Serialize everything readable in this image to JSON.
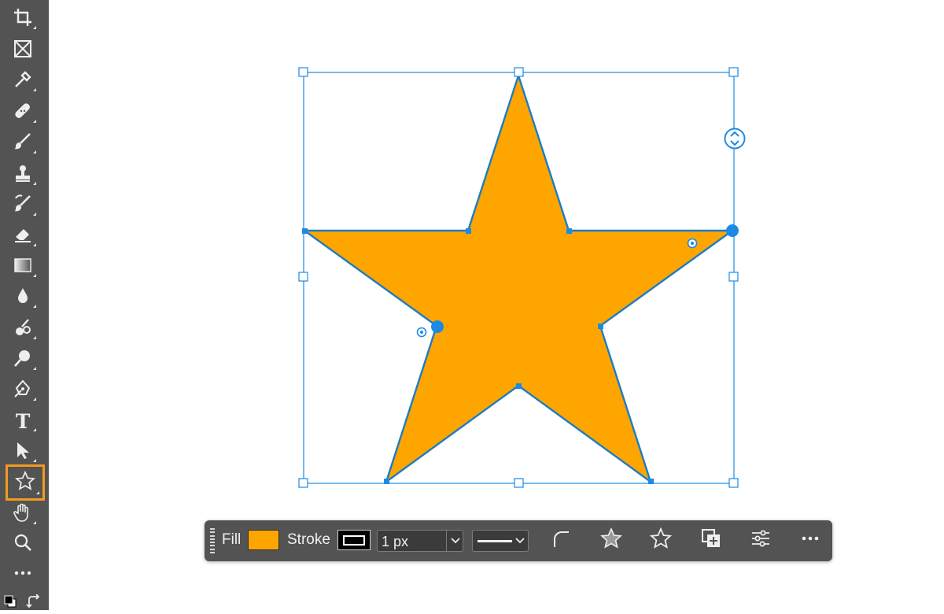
{
  "toolbar": {
    "tools": [
      {
        "icon": "crop-icon",
        "active": false
      },
      {
        "icon": "frame-icon",
        "active": false
      },
      {
        "icon": "eyedropper-icon",
        "active": false
      },
      {
        "icon": "healing-brush-icon",
        "active": false
      },
      {
        "icon": "brush-icon",
        "active": false
      },
      {
        "icon": "clone-stamp-icon",
        "active": false
      },
      {
        "icon": "history-brush-icon",
        "active": false
      },
      {
        "icon": "eraser-icon",
        "active": false
      },
      {
        "icon": "gradient-icon",
        "active": false
      },
      {
        "icon": "blur-icon",
        "active": false
      },
      {
        "icon": "dodge-icon",
        "active": false
      },
      {
        "icon": "pen-icon",
        "active": false
      },
      {
        "icon": "type-icon",
        "active": false
      },
      {
        "icon": "path-selection-icon",
        "active": false
      },
      {
        "icon": "star-shape-icon",
        "active": true
      },
      {
        "icon": "hand-icon",
        "active": false
      },
      {
        "icon": "zoom-icon",
        "active": false
      },
      {
        "icon": "more-tools-icon",
        "active": false
      },
      {
        "icon": "default-colors-icon",
        "active": false
      },
      {
        "icon": "swap-colors-icon",
        "active": false
      }
    ],
    "type_glyph": "T"
  },
  "canvas": {
    "shape": "star",
    "fill_color": "#FFA500",
    "stroke_color": "#1C7CC4",
    "selection_color": "#1B8AE6"
  },
  "taskbar": {
    "fill_label": "Fill",
    "fill_color": "#FFA500",
    "stroke_label": "Stroke",
    "stroke_color": "#000000",
    "stroke_width": "1 px",
    "stroke_style": "solid",
    "icons": [
      "round-corners-icon",
      "star-fill-icon",
      "star-outline-icon",
      "add-shape-icon",
      "properties-sliders-icon",
      "more-options-icon"
    ]
  }
}
